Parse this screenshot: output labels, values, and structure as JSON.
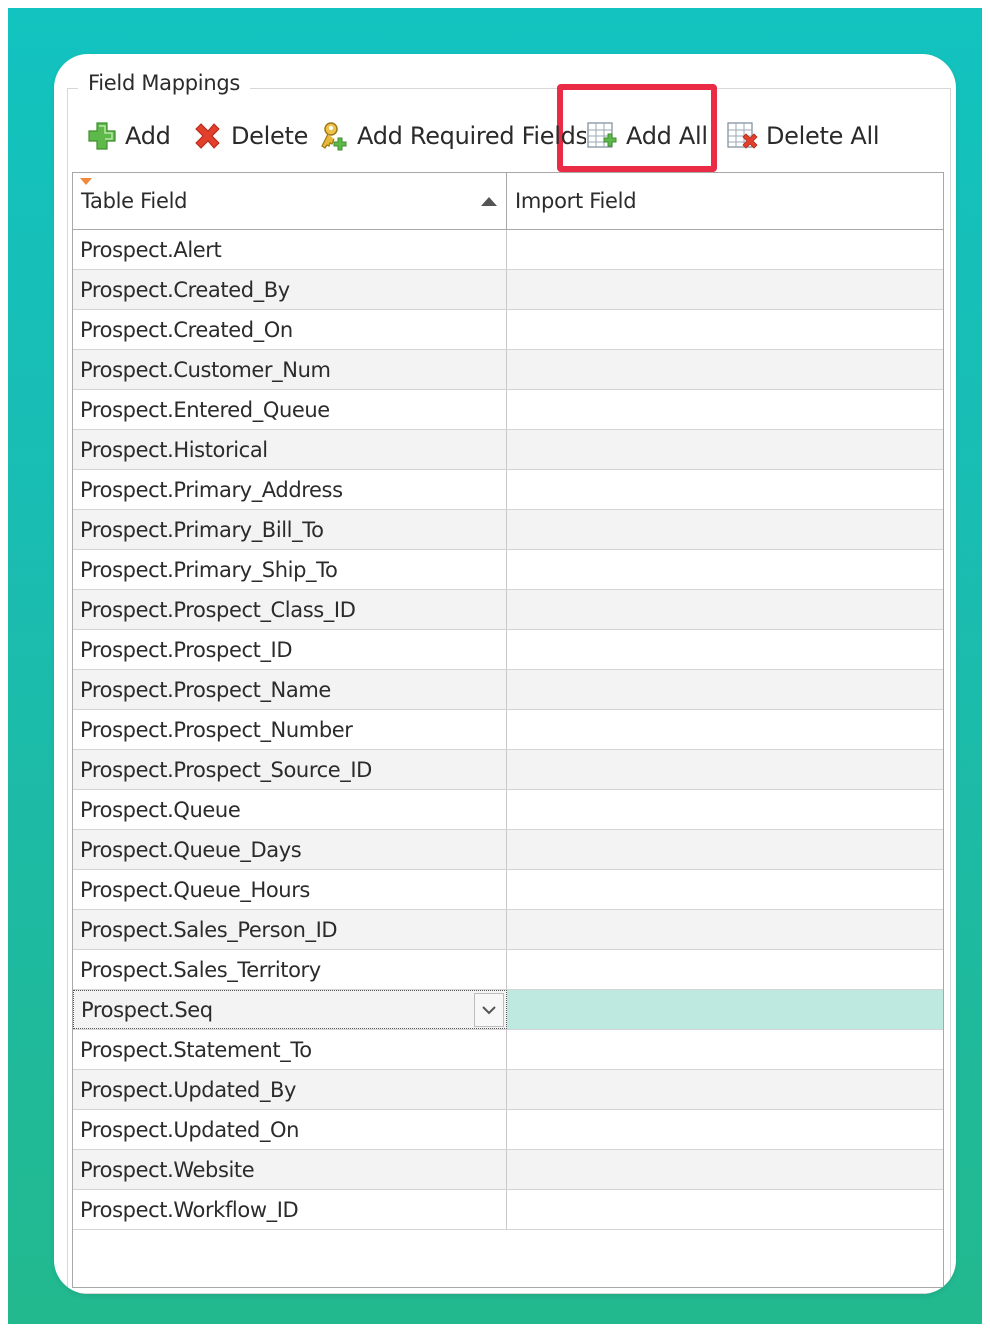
{
  "group": {
    "title": "Field Mappings"
  },
  "toolbar": {
    "add": {
      "label": "Add",
      "icon": "plus-icon"
    },
    "delete": {
      "label": "Delete",
      "icon": "delete-x-icon"
    },
    "add_required": {
      "label": "Add Required Fields",
      "icon": "add-required-key-icon"
    },
    "add_all": {
      "label": "Add All",
      "icon": "table-add-icon"
    },
    "delete_all": {
      "label": "Delete All",
      "icon": "table-delete-icon"
    }
  },
  "grid": {
    "columns": [
      "Table Field",
      "Import Field"
    ],
    "sort": {
      "column": "Table Field",
      "direction": "ascending"
    },
    "rows": [
      {
        "table_field": "Prospect.Alert",
        "import_field": ""
      },
      {
        "table_field": "Prospect.Created_By",
        "import_field": ""
      },
      {
        "table_field": "Prospect.Created_On",
        "import_field": ""
      },
      {
        "table_field": "Prospect.Customer_Num",
        "import_field": ""
      },
      {
        "table_field": "Prospect.Entered_Queue",
        "import_field": ""
      },
      {
        "table_field": "Prospect.Historical",
        "import_field": ""
      },
      {
        "table_field": "Prospect.Primary_Address",
        "import_field": ""
      },
      {
        "table_field": "Prospect.Primary_Bill_To",
        "import_field": ""
      },
      {
        "table_field": "Prospect.Primary_Ship_To",
        "import_field": ""
      },
      {
        "table_field": "Prospect.Prospect_Class_ID",
        "import_field": ""
      },
      {
        "table_field": "Prospect.Prospect_ID",
        "import_field": ""
      },
      {
        "table_field": "Prospect.Prospect_Name",
        "import_field": ""
      },
      {
        "table_field": "Prospect.Prospect_Number",
        "import_field": ""
      },
      {
        "table_field": "Prospect.Prospect_Source_ID",
        "import_field": ""
      },
      {
        "table_field": "Prospect.Queue",
        "import_field": ""
      },
      {
        "table_field": "Prospect.Queue_Days",
        "import_field": ""
      },
      {
        "table_field": "Prospect.Queue_Hours",
        "import_field": ""
      },
      {
        "table_field": "Prospect.Sales_Person_ID",
        "import_field": ""
      },
      {
        "table_field": "Prospect.Sales_Territory",
        "import_field": ""
      },
      {
        "table_field": "Prospect.Seq",
        "import_field": "",
        "selected": true
      },
      {
        "table_field": "Prospect.Statement_To",
        "import_field": ""
      },
      {
        "table_field": "Prospect.Updated_By",
        "import_field": ""
      },
      {
        "table_field": "Prospect.Updated_On",
        "import_field": ""
      },
      {
        "table_field": "Prospect.Website",
        "import_field": ""
      },
      {
        "table_field": "Prospect.Workflow_ID",
        "import_field": ""
      }
    ]
  },
  "colors": {
    "background_top": "#12c3bf",
    "background_bottom": "#22b98e",
    "highlight_border": "#ea2b45",
    "selected_row": "#bde9e0"
  }
}
